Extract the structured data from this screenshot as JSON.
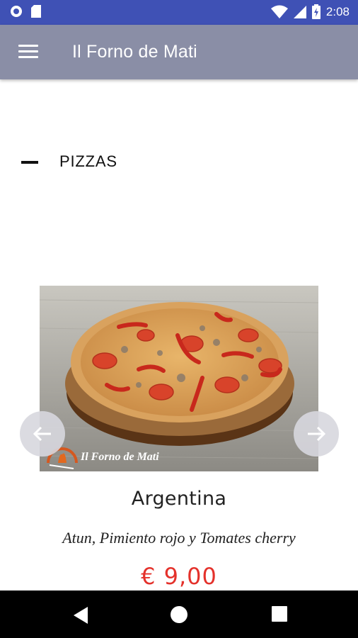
{
  "status_bar": {
    "time": "2:08"
  },
  "app_bar": {
    "title": "Il Forno de Mati"
  },
  "section": {
    "title": "PIZZAS"
  },
  "product": {
    "watermark": "Il Forno de Mati",
    "name": "Argentina",
    "description": "Atun, Pimiento rojo y Tomates cherry",
    "price": "€ 9,00"
  },
  "colors": {
    "status_bar": "#3f51b5",
    "app_bar": "#8a8ea6",
    "price": "#e4312b"
  }
}
